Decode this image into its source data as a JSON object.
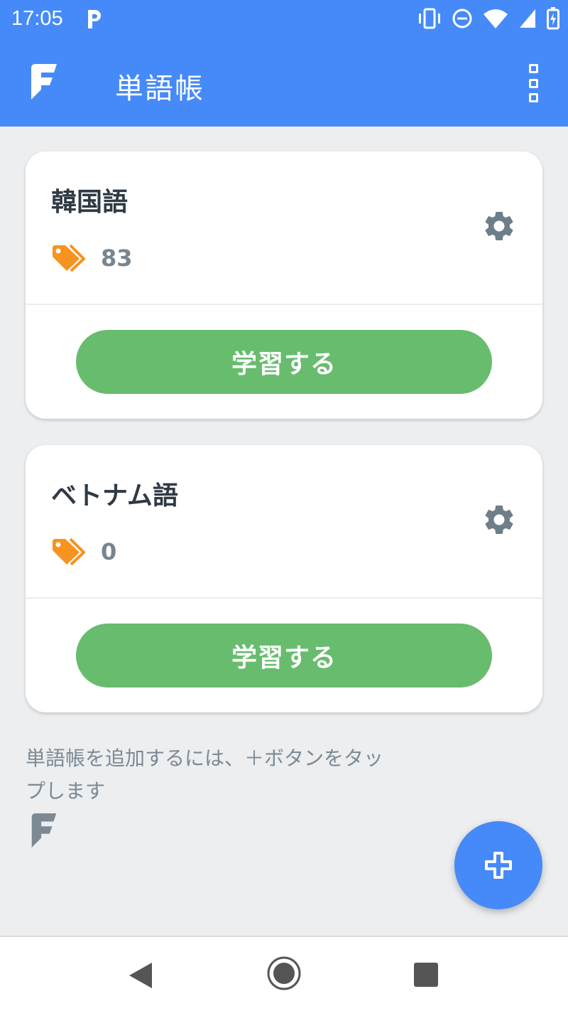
{
  "status_bar": {
    "time": "17:05",
    "icons": [
      "parking-icon",
      "vibrate-icon",
      "do-not-disturb-icon",
      "wifi-icon",
      "signal-icon",
      "battery-charging-icon"
    ]
  },
  "app_bar": {
    "title": "単語帳",
    "logo_icon": "app-logo-icon",
    "menu_icon": "overflow-menu-icon"
  },
  "decks": [
    {
      "name": "韓国語",
      "count": "83",
      "button_label": "学習する"
    },
    {
      "name": "ベトナム語",
      "count": "0",
      "button_label": "学習する"
    }
  ],
  "hint_text": "単語帳を追加するには、＋ボタンをタップします",
  "fab": {
    "icon": "plus-icon"
  },
  "colors": {
    "primary": "#458af8",
    "study_button": "#68bc6e",
    "tag": "#f7931e",
    "background": "#eceef0"
  }
}
